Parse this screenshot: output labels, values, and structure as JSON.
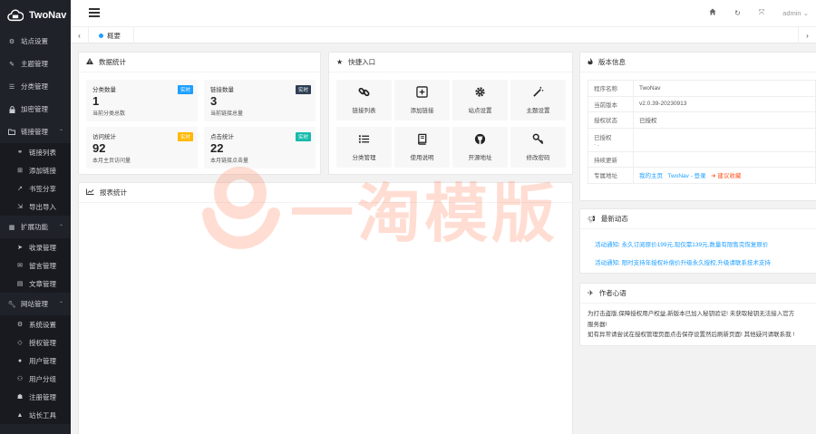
{
  "app": {
    "title": "TwoNav"
  },
  "sidebar": {
    "items": [
      {
        "label": "站点设置",
        "icon": "gear-icon"
      },
      {
        "label": "主题管理",
        "icon": "brush-icon"
      },
      {
        "label": "分类管理",
        "icon": "list-icon"
      },
      {
        "label": "加密管理",
        "icon": "lock-icon"
      },
      {
        "label": "链接管理",
        "icon": "folder-icon",
        "expanded": true,
        "children": [
          {
            "label": "链接列表",
            "icon": "link-icon"
          },
          {
            "label": "添加链接",
            "icon": "plus-icon"
          },
          {
            "label": "书签分享",
            "icon": "share-icon"
          },
          {
            "label": "导出导入",
            "icon": "export-icon"
          }
        ]
      },
      {
        "label": "扩展功能",
        "icon": "grid-icon",
        "expanded": true,
        "children": [
          {
            "label": "收录管理",
            "icon": "paperplane-icon"
          },
          {
            "label": "留言管理",
            "icon": "comment-icon"
          },
          {
            "label": "文章管理",
            "icon": "doc-icon"
          }
        ]
      },
      {
        "label": "网站管理",
        "icon": "wrench-icon",
        "expanded": true,
        "children": [
          {
            "label": "系统设置",
            "icon": "gears-icon"
          },
          {
            "label": "授权管理",
            "icon": "diamond-icon"
          },
          {
            "label": "用户管理",
            "icon": "user-icon"
          },
          {
            "label": "用户分组",
            "icon": "users-icon"
          },
          {
            "label": "注册管理",
            "icon": "register-icon"
          },
          {
            "label": "站长工具",
            "icon": "warning-icon"
          }
        ]
      }
    ]
  },
  "header": {
    "user": "admin"
  },
  "tabs": {
    "current": "概要"
  },
  "data_stats": {
    "title": "数据统计",
    "cards": [
      {
        "label": "分类数量",
        "value": "1",
        "sub": "当前分类总数",
        "badge": "实时",
        "badge_color": "#1e9fff"
      },
      {
        "label": "链接数量",
        "value": "3",
        "sub": "当前链接总量",
        "badge": "实时",
        "badge_color": "#2f4056"
      },
      {
        "label": "访问统计",
        "value": "92",
        "sub": "本月主页访问量",
        "badge": "实时",
        "badge_color": "#ffb800"
      },
      {
        "label": "点击统计",
        "value": "22",
        "sub": "本月链接点击量",
        "badge": "实时",
        "badge_color": "#16baaa"
      }
    ]
  },
  "quick": {
    "title": "快捷入口",
    "buttons": [
      {
        "label": "链接列表",
        "icon": "link-icon"
      },
      {
        "label": "添加链接",
        "icon": "plus-square-icon"
      },
      {
        "label": "站点设置",
        "icon": "gear-icon"
      },
      {
        "label": "主题设置",
        "icon": "magic-wand-icon"
      },
      {
        "label": "分类管理",
        "icon": "list-icon"
      },
      {
        "label": "使用说明",
        "icon": "book-icon"
      },
      {
        "label": "开源地址",
        "icon": "github-icon"
      },
      {
        "label": "修改密码",
        "icon": "key-icon"
      }
    ]
  },
  "report": {
    "title": "报表统计"
  },
  "version": {
    "title": "版本信息",
    "rows": [
      {
        "key": "程序名称",
        "value": "TwoNav"
      },
      {
        "key": "当前版本",
        "value": "v2.0.39-20230913"
      },
      {
        "key": "授权状态",
        "value": "已授权"
      },
      {
        "key": "已授权",
        "value": ""
      },
      {
        "key": "持续更新",
        "value": ""
      },
      {
        "key": "专属地址",
        "link1": "我的主页",
        "link2": "TwoNav - 登录",
        "link3": "建议收藏"
      }
    ]
  },
  "news": {
    "title": "最新动态",
    "items": [
      {
        "tag": "活动通知",
        "text": "永久订阅原价199元,现仅需139元,数量有限售完恢复原价"
      },
      {
        "tag": "活动通知",
        "text": "限时支持年授权补偿价升级永久授权,升级请联系技术支持"
      }
    ]
  },
  "author": {
    "title": "作者心语",
    "lines": [
      "为打击盗版,保障授权用户权益,新版本已加入秘钥验证! 未获取秘钥无法接入官方",
      "服务器!",
      "如有异常请尝试在授权管理页面点击保存设置然后刷新页面! 其他疑问请联系我 !"
    ]
  },
  "watermark": {
    "text": "一淘模版"
  }
}
